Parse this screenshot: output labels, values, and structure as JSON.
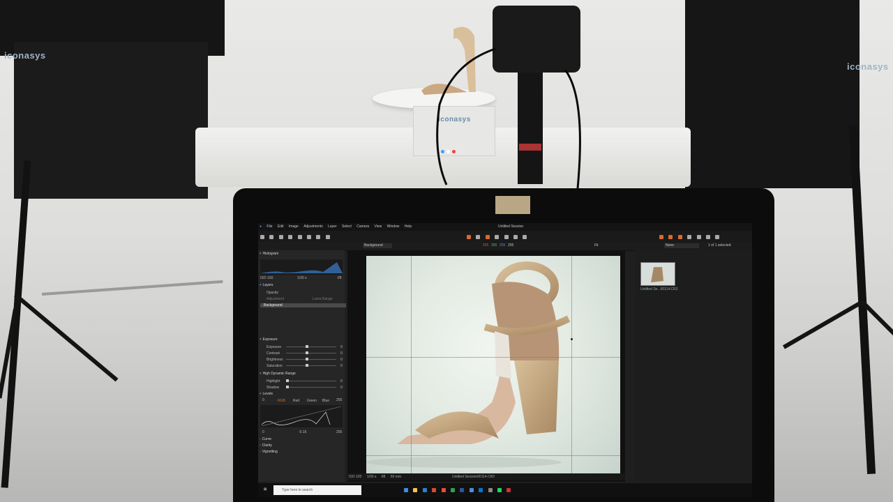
{
  "studio": {
    "brand_left": "iconasys",
    "brand_right": "iconasys",
    "turntable_label": "iconasys"
  },
  "app": {
    "menu": [
      "File",
      "Edit",
      "Image",
      "Adjustments",
      "Layer",
      "Select",
      "Camera",
      "View",
      "Window",
      "Help"
    ],
    "session_title": "Untitled Session",
    "layer_select": "Background",
    "rgb_readout": [
      "255",
      "255",
      "255",
      "255"
    ],
    "fit_label": "Fit",
    "filter_select": "None",
    "selected_count": "1 of 1 selected",
    "histogram": {
      "title": "Histogram",
      "iso": "ISO 100",
      "shutter": "1/30 s",
      "aperture": "f/8"
    },
    "layers": {
      "title": "Layers",
      "opacity": "Opacity",
      "adjustment": "Adjustment",
      "luma_range": "Luma Range",
      "background": "Background"
    },
    "exposure": {
      "title": "Exposure",
      "rows": [
        "Exposure",
        "Contrast",
        "Brightness",
        "Saturation"
      ],
      "values": [
        "0",
        "0",
        "0",
        "0"
      ]
    },
    "hdr": {
      "title": "High Dynamic Range",
      "rows": [
        "Highlight",
        "Shadow"
      ],
      "values": [
        "0",
        "0"
      ]
    },
    "levels": {
      "title": "Levels",
      "min": "0",
      "max": "255",
      "channels": [
        "RGB",
        "Red",
        "Green",
        "Blue"
      ],
      "gamma": "-0.16",
      "out_low": "0",
      "out_high": "255"
    },
    "collapsed": [
      "Curve",
      "Clarity",
      "Vignetting"
    ],
    "thumb_caption": "Untitled Se...00114.CR2",
    "status": {
      "iso": "ISO 100",
      "shutter": "1/30 s",
      "aperture": "f/8",
      "focal": "50 mm",
      "file": "Untitled Session00114.CR2"
    },
    "taskbar": {
      "search_placeholder": "Type here to search"
    }
  }
}
